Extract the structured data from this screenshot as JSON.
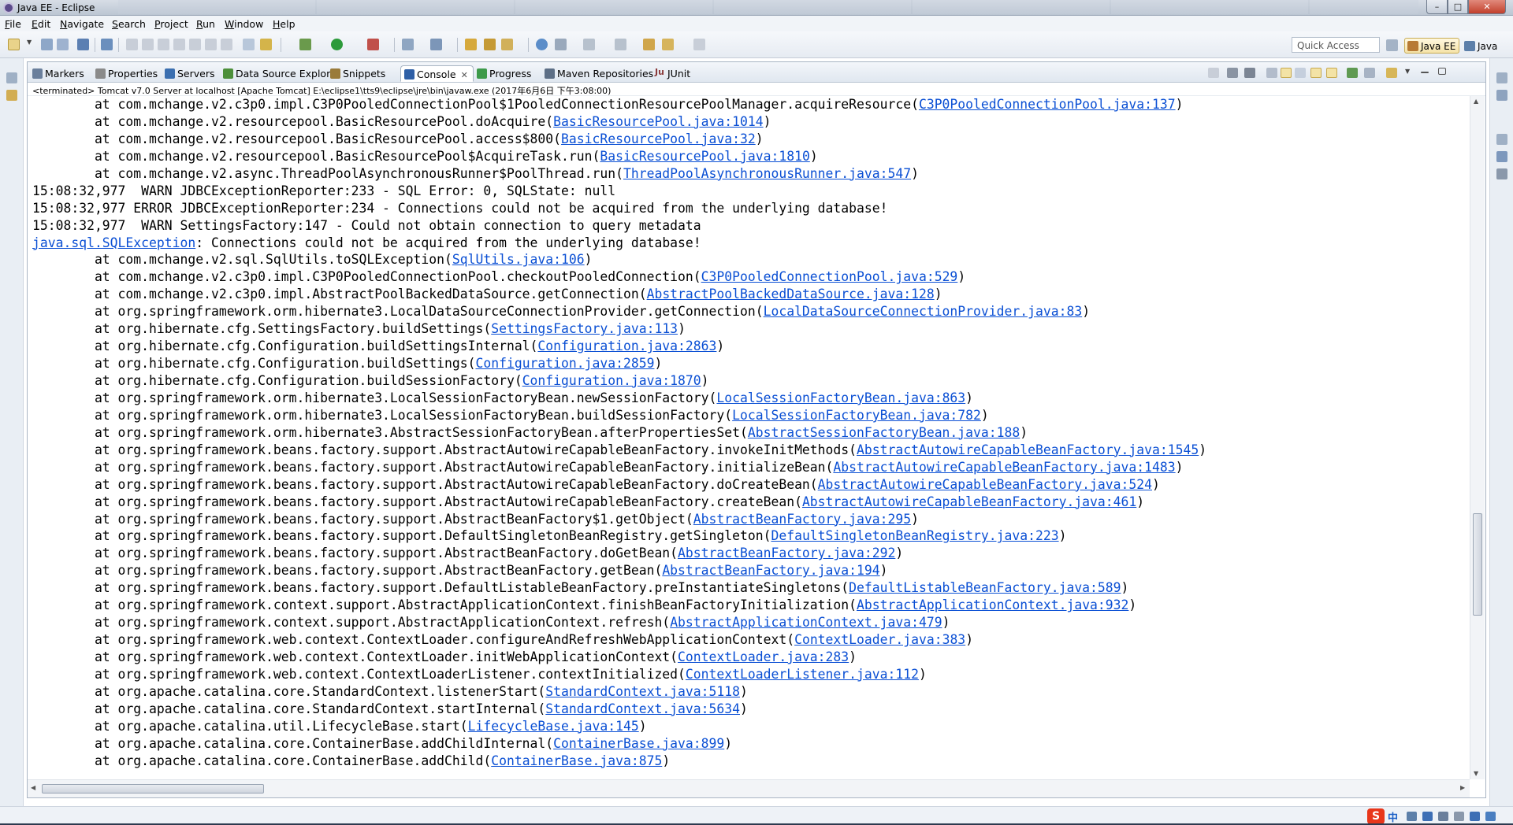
{
  "window": {
    "title": "Java EE - Eclipse",
    "controls": {
      "minimize": "–",
      "maximize": "□",
      "close": "✕"
    }
  },
  "menu": [
    {
      "mn": "F",
      "rest": "ile"
    },
    {
      "mn": "E",
      "rest": "dit"
    },
    {
      "mn": "N",
      "rest": "avigate"
    },
    {
      "mn": "S",
      "rest": "earch"
    },
    {
      "mn": "P",
      "rest": "roject"
    },
    {
      "mn": "R",
      "rest": "un"
    },
    {
      "mn": "W",
      "rest": "indow"
    },
    {
      "mn": "H",
      "rest": "elp"
    }
  ],
  "toolbar": {
    "quick_access_placeholder": "Quick Access",
    "perspectives": [
      {
        "label": "Java EE",
        "active": true,
        "icon": "java-ee-perspective-icon"
      },
      {
        "label": "Java",
        "active": false,
        "icon": "java-perspective-icon"
      }
    ]
  },
  "view_tabs": [
    {
      "label": "Markers",
      "icon": "markers-icon",
      "color": "#6a7f9c"
    },
    {
      "label": "Properties",
      "icon": "properties-icon",
      "color": "#8a8a8a"
    },
    {
      "label": "Servers",
      "icon": "servers-icon",
      "color": "#3b6fb0"
    },
    {
      "label": "Data Source Explorer",
      "icon": "data-source-icon",
      "color": "#4c8f3a"
    },
    {
      "label": "Snippets",
      "icon": "snippets-icon",
      "color": "#9a7b3a"
    },
    {
      "label": "Console",
      "icon": "console-icon",
      "color": "#2e5fa6",
      "active": true,
      "close": "✕"
    },
    {
      "label": "Progress",
      "icon": "progress-icon",
      "color": "#3d9a4a"
    },
    {
      "label": "Maven Repositories",
      "icon": "maven-icon",
      "color": "#5d6f86"
    },
    {
      "label": "JUnit",
      "icon": "junit-icon",
      "color": "#8a3a3a",
      "prefix": "Ju"
    }
  ],
  "console": {
    "terminated_line": "<terminated> Tomcat v7.0 Server at localhost [Apache Tomcat] E:\\eclipse1\\tts9\\eclipse\\jre\\bin\\javaw.exe (2017年6月6日 下午3:08:00)",
    "lines": [
      {
        "pre": "        at com.mchange.v2.c3p0.impl.C3P0PooledConnectionPool$1PooledConnectionResourcePoolManager.acquireResource(",
        "link": "C3P0PooledConnectionPool.java:137",
        "post": ")"
      },
      {
        "pre": "        at com.mchange.v2.resourcepool.BasicResourcePool.doAcquire(",
        "link": "BasicResourcePool.java:1014",
        "post": ")"
      },
      {
        "pre": "        at com.mchange.v2.resourcepool.BasicResourcePool.access$800(",
        "link": "BasicResourcePool.java:32",
        "post": ")"
      },
      {
        "pre": "        at com.mchange.v2.resourcepool.BasicResourcePool$AcquireTask.run(",
        "link": "BasicResourcePool.java:1810",
        "post": ")"
      },
      {
        "pre": "        at com.mchange.v2.async.ThreadPoolAsynchronousRunner$PoolThread.run(",
        "link": "ThreadPoolAsynchronousRunner.java:547",
        "post": ")"
      },
      {
        "pre": "15:08:32,977  WARN JDBCExceptionReporter:233 - SQL Error: 0, SQLState: null",
        "link": "",
        "post": ""
      },
      {
        "pre": "15:08:32,977 ERROR JDBCExceptionReporter:234 - Connections could not be acquired from the underlying database!",
        "link": "",
        "post": ""
      },
      {
        "pre": "15:08:32,977  WARN SettingsFactory:147 - Could not obtain connection to query metadata",
        "link": "",
        "post": ""
      },
      {
        "pre": "",
        "link": "java.sql.SQLException",
        "post": ": Connections could not be acquired from the underlying database!"
      },
      {
        "pre": "        at com.mchange.v2.sql.SqlUtils.toSQLException(",
        "link": "SqlUtils.java:106",
        "post": ")"
      },
      {
        "pre": "        at com.mchange.v2.c3p0.impl.C3P0PooledConnectionPool.checkoutPooledConnection(",
        "link": "C3P0PooledConnectionPool.java:529",
        "post": ")"
      },
      {
        "pre": "        at com.mchange.v2.c3p0.impl.AbstractPoolBackedDataSource.getConnection(",
        "link": "AbstractPoolBackedDataSource.java:128",
        "post": ")"
      },
      {
        "pre": "        at org.springframework.orm.hibernate3.LocalDataSourceConnectionProvider.getConnection(",
        "link": "LocalDataSourceConnectionProvider.java:83",
        "post": ")"
      },
      {
        "pre": "        at org.hibernate.cfg.SettingsFactory.buildSettings(",
        "link": "SettingsFactory.java:113",
        "post": ")"
      },
      {
        "pre": "        at org.hibernate.cfg.Configuration.buildSettingsInternal(",
        "link": "Configuration.java:2863",
        "post": ")"
      },
      {
        "pre": "        at org.hibernate.cfg.Configuration.buildSettings(",
        "link": "Configuration.java:2859",
        "post": ")"
      },
      {
        "pre": "        at org.hibernate.cfg.Configuration.buildSessionFactory(",
        "link": "Configuration.java:1870",
        "post": ")"
      },
      {
        "pre": "        at org.springframework.orm.hibernate3.LocalSessionFactoryBean.newSessionFactory(",
        "link": "LocalSessionFactoryBean.java:863",
        "post": ")"
      },
      {
        "pre": "        at org.springframework.orm.hibernate3.LocalSessionFactoryBean.buildSessionFactory(",
        "link": "LocalSessionFactoryBean.java:782",
        "post": ")"
      },
      {
        "pre": "        at org.springframework.orm.hibernate3.AbstractSessionFactoryBean.afterPropertiesSet(",
        "link": "AbstractSessionFactoryBean.java:188",
        "post": ")"
      },
      {
        "pre": "        at org.springframework.beans.factory.support.AbstractAutowireCapableBeanFactory.invokeInitMethods(",
        "link": "AbstractAutowireCapableBeanFactory.java:1545",
        "post": ")"
      },
      {
        "pre": "        at org.springframework.beans.factory.support.AbstractAutowireCapableBeanFactory.initializeBean(",
        "link": "AbstractAutowireCapableBeanFactory.java:1483",
        "post": ")"
      },
      {
        "pre": "        at org.springframework.beans.factory.support.AbstractAutowireCapableBeanFactory.doCreateBean(",
        "link": "AbstractAutowireCapableBeanFactory.java:524",
        "post": ")"
      },
      {
        "pre": "        at org.springframework.beans.factory.support.AbstractAutowireCapableBeanFactory.createBean(",
        "link": "AbstractAutowireCapableBeanFactory.java:461",
        "post": ")"
      },
      {
        "pre": "        at org.springframework.beans.factory.support.AbstractBeanFactory$1.getObject(",
        "link": "AbstractBeanFactory.java:295",
        "post": ")"
      },
      {
        "pre": "        at org.springframework.beans.factory.support.DefaultSingletonBeanRegistry.getSingleton(",
        "link": "DefaultSingletonBeanRegistry.java:223",
        "post": ")"
      },
      {
        "pre": "        at org.springframework.beans.factory.support.AbstractBeanFactory.doGetBean(",
        "link": "AbstractBeanFactory.java:292",
        "post": ")"
      },
      {
        "pre": "        at org.springframework.beans.factory.support.AbstractBeanFactory.getBean(",
        "link": "AbstractBeanFactory.java:194",
        "post": ")"
      },
      {
        "pre": "        at org.springframework.beans.factory.support.DefaultListableBeanFactory.preInstantiateSingletons(",
        "link": "DefaultListableBeanFactory.java:589",
        "post": ")"
      },
      {
        "pre": "        at org.springframework.context.support.AbstractApplicationContext.finishBeanFactoryInitialization(",
        "link": "AbstractApplicationContext.java:932",
        "post": ")"
      },
      {
        "pre": "        at org.springframework.context.support.AbstractApplicationContext.refresh(",
        "link": "AbstractApplicationContext.java:479",
        "post": ")"
      },
      {
        "pre": "        at org.springframework.web.context.ContextLoader.configureAndRefreshWebApplicationContext(",
        "link": "ContextLoader.java:383",
        "post": ")"
      },
      {
        "pre": "        at org.springframework.web.context.ContextLoader.initWebApplicationContext(",
        "link": "ContextLoader.java:283",
        "post": ")"
      },
      {
        "pre": "        at org.springframework.web.context.ContextLoaderListener.contextInitialized(",
        "link": "ContextLoaderListener.java:112",
        "post": ")"
      },
      {
        "pre": "        at org.apache.catalina.core.StandardContext.listenerStart(",
        "link": "StandardContext.java:5118",
        "post": ")"
      },
      {
        "pre": "        at org.apache.catalina.core.StandardContext.startInternal(",
        "link": "StandardContext.java:5634",
        "post": ")"
      },
      {
        "pre": "        at org.apache.catalina.util.LifecycleBase.start(",
        "link": "LifecycleBase.java:145",
        "post": ")"
      },
      {
        "pre": "        at org.apache.catalina.core.ContainerBase.addChildInternal(",
        "link": "ContainerBase.java:899",
        "post": ")"
      },
      {
        "pre": "        at org.apache.catalina.core.ContainerBase.addChild(",
        "link": "ContainerBase.java:875",
        "post": ")"
      }
    ]
  },
  "tray": {
    "ime_logo": "S",
    "ime_mode": "中"
  },
  "colors": {
    "link": "#0a4fd4",
    "active_perspective": "#f5e3a8",
    "titlebar": "#c6cfdb"
  }
}
